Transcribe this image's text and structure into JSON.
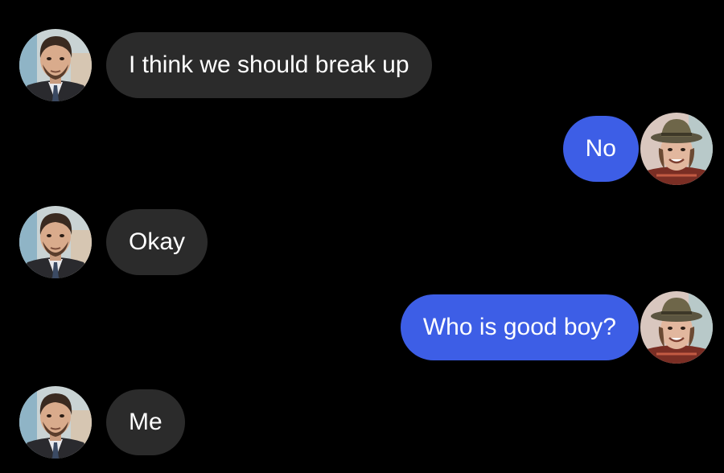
{
  "conversation": {
    "messages": [
      {
        "direction": "incoming",
        "sender_avatar": "bearded-man-avatar",
        "text": "I think we should break up"
      },
      {
        "direction": "outgoing",
        "sender_avatar": "hat-man-avatar",
        "text": "No"
      },
      {
        "direction": "incoming",
        "sender_avatar": "bearded-man-avatar",
        "text": "Okay"
      },
      {
        "direction": "outgoing",
        "sender_avatar": "hat-man-avatar",
        "text": "Who is good boy?"
      },
      {
        "direction": "incoming",
        "sender_avatar": "bearded-man-avatar",
        "text": "Me"
      }
    ]
  },
  "colors": {
    "background": "#000000",
    "incoming_bubble": "#2b2b2b",
    "outgoing_bubble": "#3d5ee6",
    "text": "#ffffff"
  }
}
